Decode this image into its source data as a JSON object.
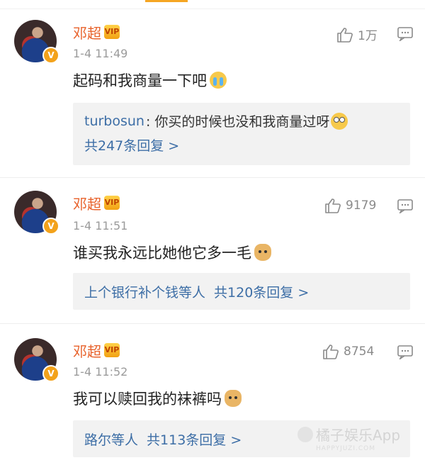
{
  "comments": [
    {
      "name": "邓超",
      "time": "1-4 11:49",
      "likes": "1万",
      "content": "起码和我商量一下吧",
      "emoji": "crying-emoji",
      "reply": {
        "user": "turbosun",
        "text": ": 你买的时候也没和我商量过呀",
        "emoji": "eye-roll-emoji",
        "total": "共247条回复 >"
      }
    },
    {
      "name": "邓超",
      "time": "1-4 11:51",
      "likes": "9179",
      "content": "谁买我永远比她他它多一毛",
      "emoji": "doge-emoji",
      "reply": {
        "users": "上个银行补个钱等人",
        "total": "共120条回复 >"
      }
    },
    {
      "name": "邓超",
      "time": "1-4 11:52",
      "likes": "8754",
      "content": "我可以赎回我的袜裤吗",
      "emoji": "doge-emoji",
      "reply": {
        "users": "路尔等人",
        "total": "共113条回复 >"
      }
    }
  ],
  "badges": {
    "verified": "V",
    "crown": "VIP"
  },
  "watermark": {
    "main": "橘子娱乐App",
    "sub": "HAPPYJUZI.COM"
  },
  "colors": {
    "name": "#e8622b",
    "link": "#3d6ea6",
    "accent": "#f5a623"
  }
}
